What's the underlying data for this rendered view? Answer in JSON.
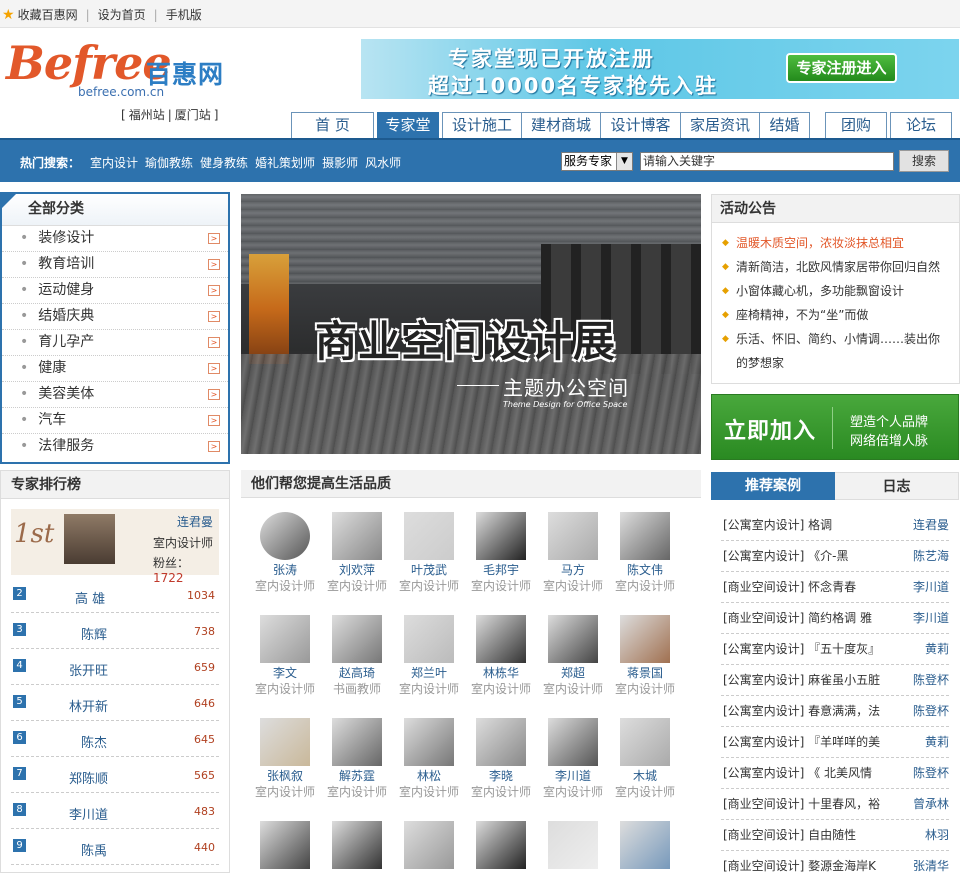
{
  "topbar": {
    "fav": "收藏百惠网",
    "home": "设为首页",
    "mobile": "手机版"
  },
  "logo": {
    "brand": "Befree",
    "cn": "百惠网",
    "url": "befree.com.cn"
  },
  "stations": {
    "fz": "福州站",
    "xm": "厦门站"
  },
  "banner": {
    "line1": "专家堂现已开放注册",
    "line2": "超过10000名专家抢先入驻",
    "button": "专家注册进入"
  },
  "nav": [
    "首 页",
    "专家堂",
    "设计施工",
    "建材商城",
    "设计博客",
    "家居资讯",
    "结婚",
    "团购",
    "论坛"
  ],
  "search": {
    "hot_label": "热门搜索：",
    "keywords": [
      "室内设计",
      "瑜伽教练",
      "健身教练",
      "婚礼策划师",
      "摄影师",
      "风水师"
    ],
    "select": "服务专家",
    "placeholder": "请输入关键字",
    "button": "搜索"
  },
  "categories": {
    "title": "全部分类",
    "items": [
      "装修设计",
      "教育培训",
      "运动健身",
      "结婚庆典",
      "育儿孕产",
      "健康",
      "美容美体",
      "汽车",
      "法律服务"
    ]
  },
  "hero": {
    "title": "商业空间设计展",
    "subtitle": "主题办公空间",
    "en": "Theme Design for Office Space"
  },
  "notice": {
    "title": "活动公告",
    "items": [
      "温暖木质空间，浓妆淡抹总相宜",
      "清新简洁，北欧风情家居带你回归自然",
      "小窗体藏心机，多功能飘窗设计",
      "座椅精神，不为“坐”而做",
      "乐活、怀旧、简约、小情调……装出你",
      "的梦想家"
    ]
  },
  "join": {
    "big": "立即加入",
    "s1": "塑造个人品牌",
    "s2": "网络倍增人脉"
  },
  "rank": {
    "title": "专家排行榜",
    "first": {
      "no": "1st",
      "name": "连君曼",
      "job": "室内设计师",
      "fans_label": "粉丝：",
      "fans": "1722"
    },
    "rows": [
      {
        "n": "2",
        "name": "高 雄",
        "score": "1034"
      },
      {
        "n": "3",
        "name": "陈辉",
        "score": "738"
      },
      {
        "n": "4",
        "name": "张开旺",
        "score": "659"
      },
      {
        "n": "5",
        "name": "林开新",
        "score": "646"
      },
      {
        "n": "6",
        "name": "陈杰",
        "score": "645"
      },
      {
        "n": "7",
        "name": "郑陈顺",
        "score": "565"
      },
      {
        "n": "8",
        "name": "李川道",
        "score": "483"
      },
      {
        "n": "9",
        "name": "陈禹",
        "score": "440"
      }
    ]
  },
  "mid": {
    "title": "他们帮您提高生活品质",
    "people": [
      {
        "name": "张涛",
        "job": "室内设计师"
      },
      {
        "name": "刘欢萍",
        "job": "室内设计师"
      },
      {
        "name": "叶茂武",
        "job": "室内设计师"
      },
      {
        "name": "毛邦宇",
        "job": "室内设计师"
      },
      {
        "name": "马方",
        "job": "室内设计师"
      },
      {
        "name": "陈文伟",
        "job": "室内设计师"
      },
      {
        "name": "李文",
        "job": "室内设计师"
      },
      {
        "name": "赵高琦",
        "job": "书画教师"
      },
      {
        "name": "郑兰叶",
        "job": "室内设计师"
      },
      {
        "name": "林栋华",
        "job": "室内设计师"
      },
      {
        "name": "郑超",
        "job": "室内设计师"
      },
      {
        "name": "蒋景国",
        "job": "室内设计师"
      },
      {
        "name": "张枫叙",
        "job": "室内设计师"
      },
      {
        "name": "解苏霆",
        "job": "室内设计师"
      },
      {
        "name": "林松",
        "job": "室内设计师"
      },
      {
        "name": "李晓",
        "job": "室内设计师"
      },
      {
        "name": "李川道",
        "job": "室内设计师"
      },
      {
        "name": "木城",
        "job": "室内设计师"
      },
      {
        "name": "",
        "job": ""
      },
      {
        "name": "",
        "job": ""
      },
      {
        "name": "",
        "job": ""
      },
      {
        "name": "",
        "job": ""
      },
      {
        "name": "",
        "job": ""
      },
      {
        "name": "",
        "job": ""
      }
    ]
  },
  "cases": {
    "tab_on": "推荐案例",
    "tab_off": "日志",
    "rows": [
      {
        "t": "[公寓室内设计] 格调",
        "a": "连君曼"
      },
      {
        "t": "[公寓室内设计] 《介-黑",
        "a": "陈艺海"
      },
      {
        "t": "[商业空间设计] 怀念青春",
        "a": "李川道"
      },
      {
        "t": "[商业空间设计] 简约格调 雅",
        "a": "李川道"
      },
      {
        "t": "[公寓室内设计] 『五十度灰』",
        "a": "黄莉"
      },
      {
        "t": "[公寓室内设计] 麻雀虽小五脏",
        "a": "陈登杯"
      },
      {
        "t": "[公寓室内设计] 春意满满，法",
        "a": "陈登杯"
      },
      {
        "t": "[公寓室内设计] 『羊咩咩的美",
        "a": "黄莉"
      },
      {
        "t": "[公寓室内设计] 《 北美风情",
        "a": "陈登杯"
      },
      {
        "t": "[商业空间设计] 十里春风，裕",
        "a": "曾承林"
      },
      {
        "t": "[商业空间设计] 自由随性",
        "a": "林羽"
      },
      {
        "t": "[商业空间设计] 婺源金海岸K",
        "a": "张清华"
      }
    ]
  }
}
